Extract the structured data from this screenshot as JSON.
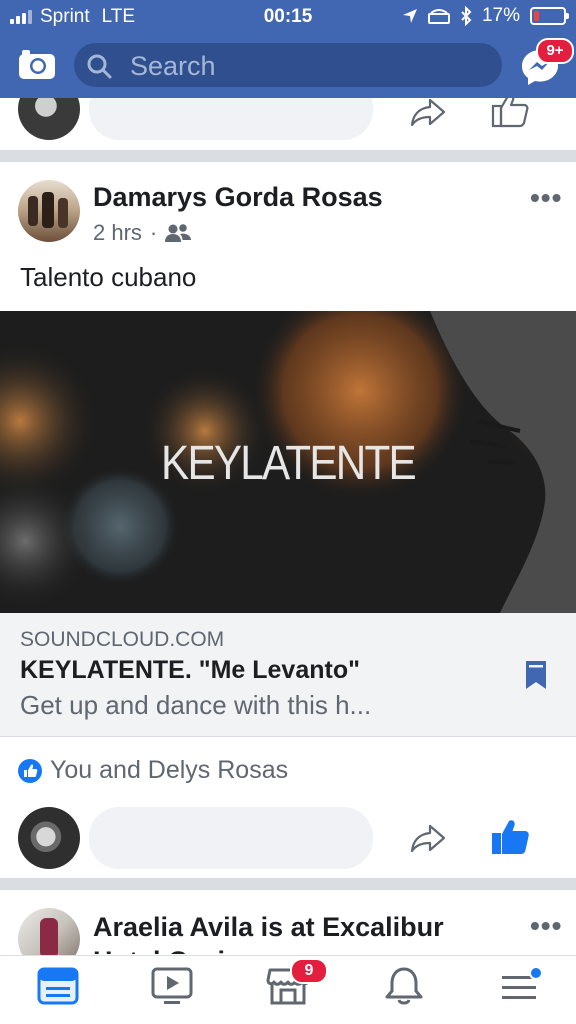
{
  "status_bar": {
    "carrier": "Sprint",
    "network": "LTE",
    "time": "00:15",
    "battery": "17%",
    "battery_level": 0.17
  },
  "header": {
    "search_placeholder": "Search",
    "messenger_badge": "9+"
  },
  "post": {
    "author": "Damarys Gorda Rosas",
    "time": "2 hrs",
    "privacy_separator": "·",
    "text": "Talento cubano",
    "link": {
      "image_title": "KEYLATENTE",
      "domain": "SOUNDCLOUD.COM",
      "title": "KEYLATENTE. \"Me Levanto\"",
      "description": "Get up and dance with this h..."
    },
    "reactions": "You and Delys Rosas",
    "more_label": "•••"
  },
  "next_post": {
    "author": "Araelia Avila is at Excalibur Hotel Casino",
    "more_label": "•••"
  },
  "tabbar": {
    "marketplace_badge": "9"
  },
  "colors": {
    "brand": "#4267b2",
    "like": "#1877f2",
    "badge": "#e41e3f"
  }
}
